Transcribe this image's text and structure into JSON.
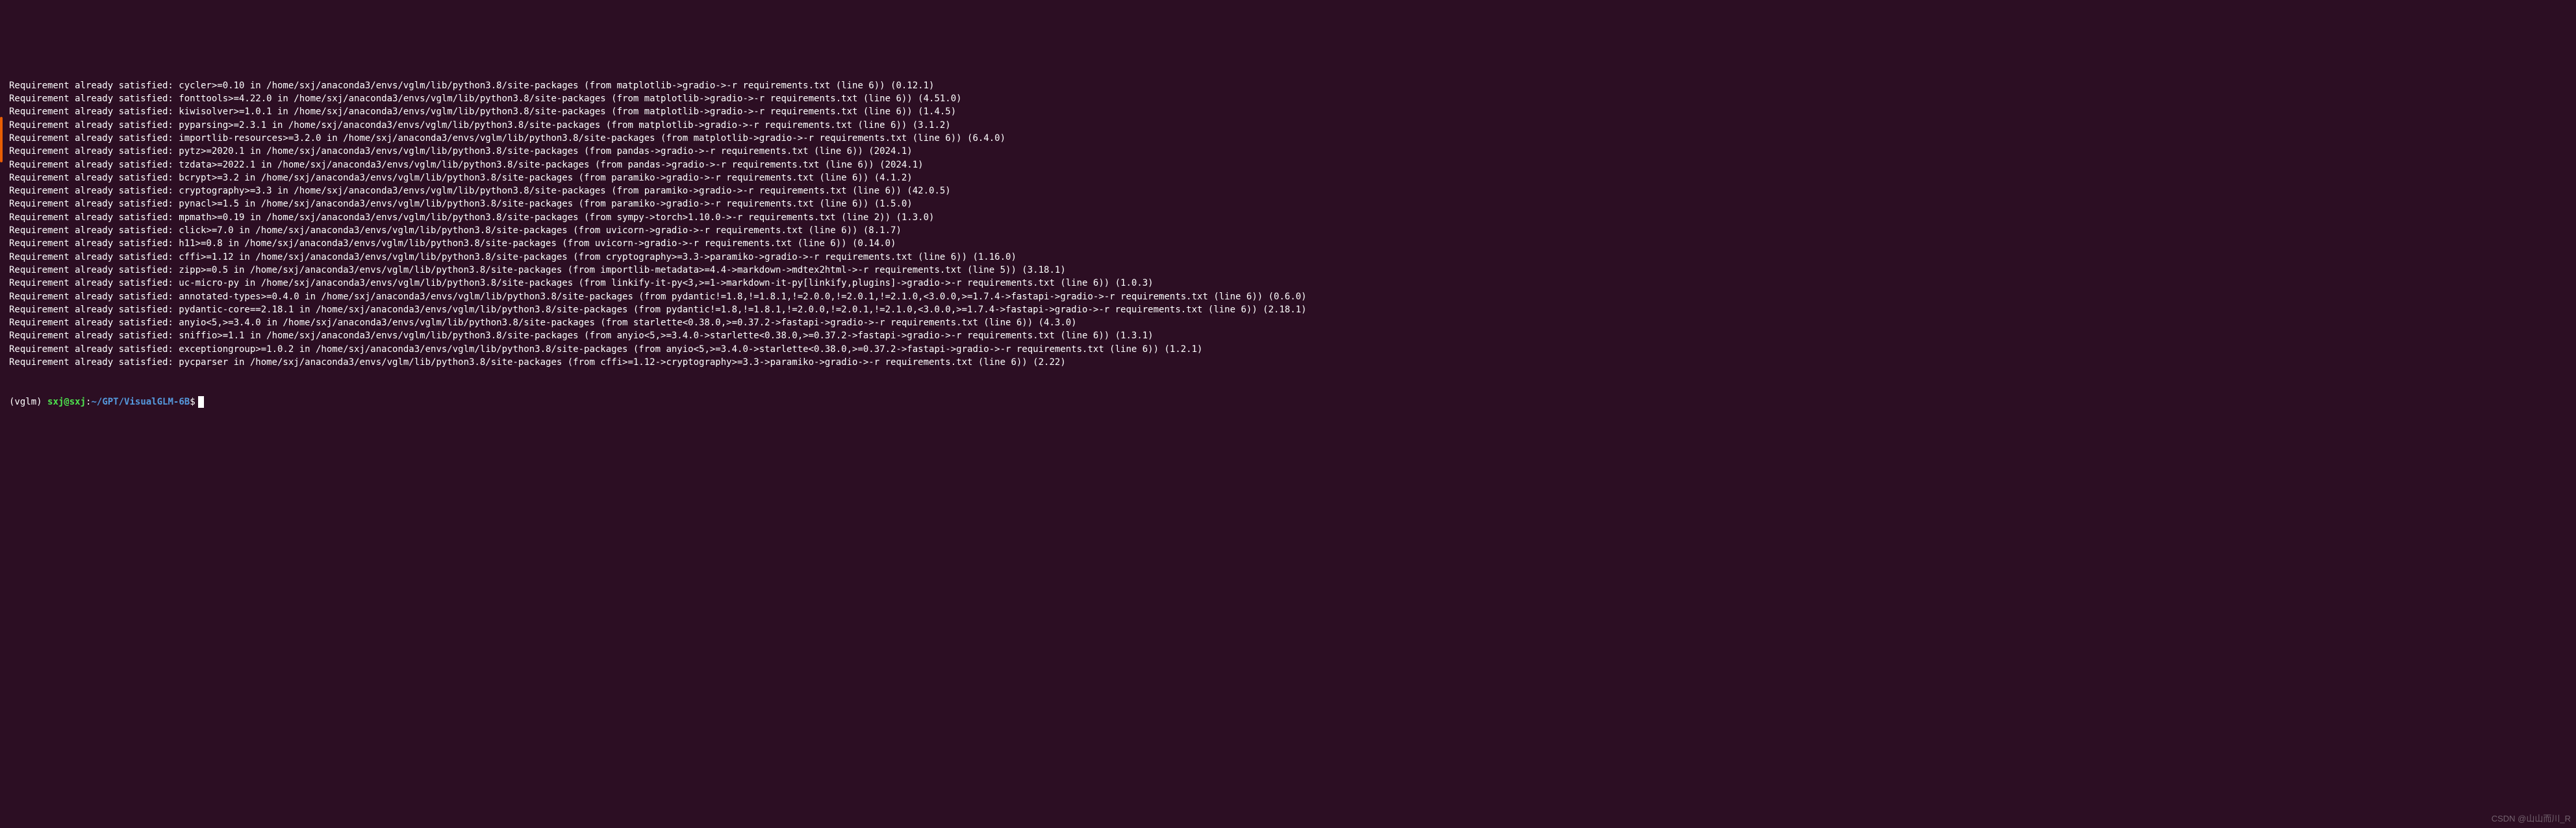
{
  "colors": {
    "background": "#2c0e23",
    "foreground": "#ffffff",
    "prompt_user": "#4ee44e",
    "prompt_path": "#5599dd",
    "scrollbar": "#e85d04"
  },
  "prefix": "Requirement already satisfied: ",
  "site_packages_path": "/home/sxj/anaconda3/envs/vglm/lib/python3.8/site-packages",
  "lines": [
    {
      "pkg": "cycler>=0.10",
      "path": "/home/sxj/anaconda3/envs/vglm/lib/python3.8/site-packages",
      "from": "matplotlib->gradio->-r requirements.txt (line 6)",
      "ver": "0.12.1"
    },
    {
      "pkg": "fonttools>=4.22.0",
      "path": "/home/sxj/anaconda3/envs/vglm/lib/python3.8/site-packages",
      "from": "matplotlib->gradio->-r requirements.txt (line 6)",
      "ver": "4.51.0"
    },
    {
      "pkg": "kiwisolver>=1.0.1",
      "path": "/home/sxj/anaconda3/envs/vglm/lib/python3.8/site-packages",
      "from": "matplotlib->gradio->-r requirements.txt (line 6)",
      "ver": "1.4.5"
    },
    {
      "pkg": "pyparsing>=2.3.1",
      "path": "/home/sxj/anaconda3/envs/vglm/lib/python3.8/site-packages",
      "from": "matplotlib->gradio->-r requirements.txt (line 6)",
      "ver": "3.1.2"
    },
    {
      "pkg": "importlib-resources>=3.2.0",
      "path": "/home/sxj/anaconda3/envs/vglm/lib/python3.8/site-packages",
      "from": "matplotlib->gradio->-r requirements.txt (line 6)",
      "ver": "6.4.0"
    },
    {
      "pkg": "pytz>=2020.1",
      "path": "/home/sxj/anaconda3/envs/vglm/lib/python3.8/site-packages",
      "from": "pandas->gradio->-r requirements.txt (line 6)",
      "ver": "2024.1"
    },
    {
      "pkg": "tzdata>=2022.1",
      "path": "/home/sxj/anaconda3/envs/vglm/lib/python3.8/site-packages",
      "from": "pandas->gradio->-r requirements.txt (line 6)",
      "ver": "2024.1"
    },
    {
      "pkg": "bcrypt>=3.2",
      "path": "/home/sxj/anaconda3/envs/vglm/lib/python3.8/site-packages",
      "from": "paramiko->gradio->-r requirements.txt (line 6)",
      "ver": "4.1.2"
    },
    {
      "pkg": "cryptography>=3.3",
      "path": "/home/sxj/anaconda3/envs/vglm/lib/python3.8/site-packages",
      "from": "paramiko->gradio->-r requirements.txt (line 6)",
      "ver": "42.0.5"
    },
    {
      "pkg": "pynacl>=1.5",
      "path": "/home/sxj/anaconda3/envs/vglm/lib/python3.8/site-packages",
      "from": "paramiko->gradio->-r requirements.txt (line 6)",
      "ver": "1.5.0"
    },
    {
      "pkg": "mpmath>=0.19",
      "path": "/home/sxj/anaconda3/envs/vglm/lib/python3.8/site-packages",
      "from": "sympy->torch>1.10.0->-r requirements.txt (line 2)",
      "ver": "1.3.0"
    },
    {
      "pkg": "click>=7.0",
      "path": "/home/sxj/anaconda3/envs/vglm/lib/python3.8/site-packages",
      "from": "uvicorn->gradio->-r requirements.txt (line 6)",
      "ver": "8.1.7"
    },
    {
      "pkg": "h11>=0.8",
      "path": "/home/sxj/anaconda3/envs/vglm/lib/python3.8/site-packages",
      "from": "uvicorn->gradio->-r requirements.txt (line 6)",
      "ver": "0.14.0"
    },
    {
      "pkg": "cffi>=1.12",
      "path": "/home/sxj/anaconda3/envs/vglm/lib/python3.8/site-packages",
      "from": "cryptography>=3.3->paramiko->gradio->-r requirements.txt (line 6)",
      "ver": "1.16.0"
    },
    {
      "pkg": "zipp>=0.5",
      "path": "/home/sxj/anaconda3/envs/vglm/lib/python3.8/site-packages",
      "from": "importlib-metadata>=4.4->markdown->mdtex2html->-r requirements.txt (line 5)",
      "ver": "3.18.1"
    },
    {
      "pkg": "uc-micro-py",
      "path": "/home/sxj/anaconda3/envs/vglm/lib/python3.8/site-packages",
      "from": "linkify-it-py<3,>=1->markdown-it-py[linkify,plugins]->gradio->-r requirements.txt (line 6)",
      "ver": "1.0.3"
    },
    {
      "pkg": "annotated-types>=0.4.0",
      "path": "/home/sxj/anaconda3/envs/vglm/lib/python3.8/site-packages",
      "from": "pydantic!=1.8,!=1.8.1,!=2.0.0,!=2.0.1,!=2.1.0,<3.0.0,>=1.7.4->fastapi->gradio->-r requirements.txt (line 6)",
      "ver": "0.6.0"
    },
    {
      "pkg": "pydantic-core==2.18.1",
      "path": "/home/sxj/anaconda3/envs/vglm/lib/python3.8/site-packages",
      "from": "pydantic!=1.8,!=1.8.1,!=2.0.0,!=2.0.1,!=2.1.0,<3.0.0,>=1.7.4->fastapi->gradio->-r requirements.txt (line 6)",
      "ver": "2.18.1"
    },
    {
      "pkg": "anyio<5,>=3.4.0",
      "path": "/home/sxj/anaconda3/envs/vglm/lib/python3.8/site-packages",
      "from": "starlette<0.38.0,>=0.37.2->fastapi->gradio->-r requirements.txt (line 6)",
      "ver": "4.3.0"
    },
    {
      "pkg": "sniffio>=1.1",
      "path": "/home/sxj/anaconda3/envs/vglm/lib/python3.8/site-packages",
      "from": "anyio<5,>=3.4.0->starlette<0.38.0,>=0.37.2->fastapi->gradio->-r requirements.txt (line 6)",
      "ver": "1.3.1"
    },
    {
      "pkg": "exceptiongroup>=1.0.2",
      "path": "/home/sxj/anaconda3/envs/vglm/lib/python3.8/site-packages",
      "from": "anyio<5,>=3.4.0->starlette<0.38.0,>=0.37.2->fastapi->gradio->-r requirements.txt (line 6)",
      "ver": "1.2.1"
    },
    {
      "pkg": "pycparser",
      "path": "/home/sxj/anaconda3/envs/vglm/lib/python3.8/site-packages",
      "from": "cffi>=1.12->cryptography>=3.3->paramiko->gradio->-r requirements.txt (line 6)",
      "ver": "2.22"
    }
  ],
  "prompt": {
    "env": "(vglm) ",
    "user_host": "sxj@sxj",
    "colon": ":",
    "path": "~/GPT/VisualGLM-6B",
    "dollar": "$"
  },
  "watermark": "CSDN @山山而川_R"
}
